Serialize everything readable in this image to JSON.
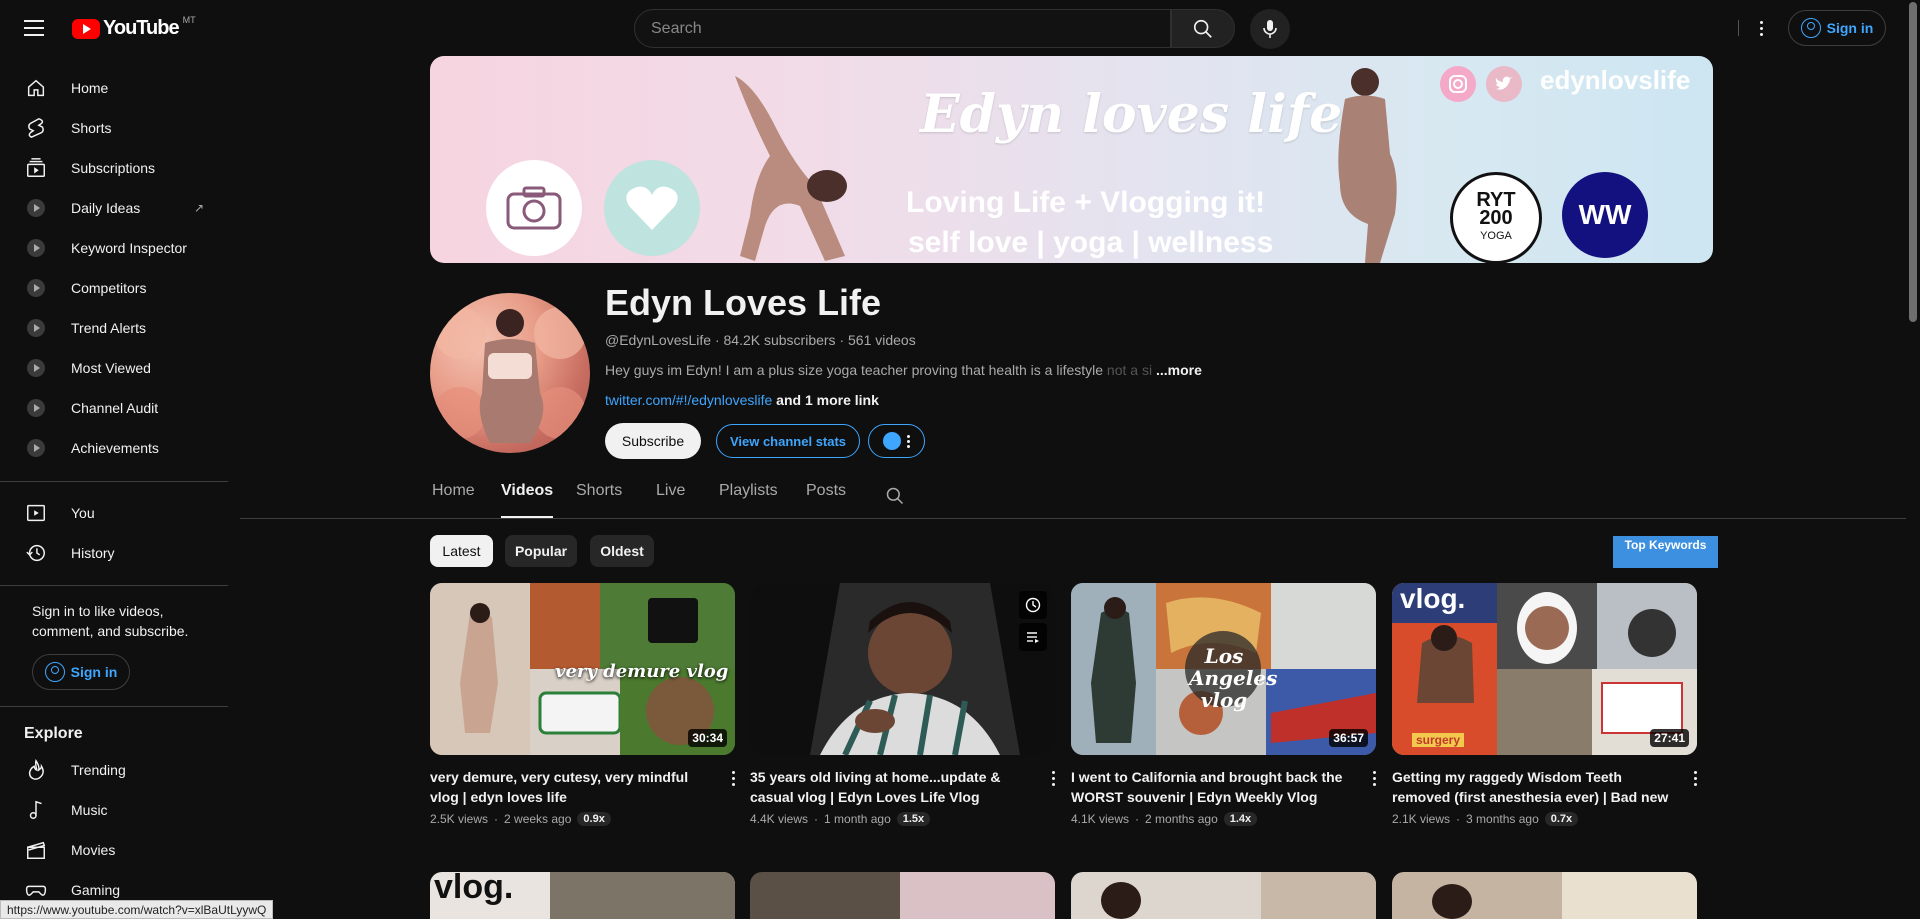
{
  "header": {
    "logo_text": "YouTube",
    "country_code": "MT",
    "search_placeholder": "Search",
    "signin_label": "Sign in"
  },
  "sidebar": {
    "items": [
      {
        "label": "Home",
        "icon": "home-icon"
      },
      {
        "label": "Shorts",
        "icon": "shorts-icon"
      },
      {
        "label": "Subscriptions",
        "icon": "subscriptions-icon"
      },
      {
        "label": "Daily Ideas",
        "icon": "extension-icon"
      },
      {
        "label": "Keyword Inspector",
        "icon": "extension-icon"
      },
      {
        "label": "Competitors",
        "icon": "extension-icon"
      },
      {
        "label": "Trend Alerts",
        "icon": "extension-icon"
      },
      {
        "label": "Most Viewed",
        "icon": "extension-icon"
      },
      {
        "label": "Channel Audit",
        "icon": "extension-icon"
      },
      {
        "label": "Achievements",
        "icon": "extension-icon"
      }
    ],
    "you_items": [
      {
        "label": "You",
        "icon": "you-icon"
      },
      {
        "label": "History",
        "icon": "history-icon"
      }
    ],
    "signin_prompt": "Sign in to like videos, comment, and subscribe.",
    "signin_label": "Sign in",
    "explore_heading": "Explore",
    "explore_items": [
      {
        "label": "Trending",
        "icon": "trending-icon"
      },
      {
        "label": "Music",
        "icon": "music-icon"
      },
      {
        "label": "Movies",
        "icon": "movies-icon"
      },
      {
        "label": "Gaming",
        "icon": "gaming-icon"
      }
    ]
  },
  "banner": {
    "title": "Edyn loves life",
    "tagline1": "Loving Life + Vlogging it!",
    "tagline2": "self love | yoga | wellness",
    "handle": "edynlovslife",
    "ryt_top": "RYT",
    "ryt_num": "200",
    "ryt_yoga": "YOGA",
    "ww": "WW"
  },
  "channel": {
    "name": "Edyn Loves Life",
    "meta": "@EdynLovesLife · 84.2K subscribers · 561 videos",
    "description_visible": "Hey guys im Edyn!  I am a plus size yoga teacher proving that health is a lifestyle ",
    "description_faded": "not a si",
    "more_label": "...more",
    "link_text": "twitter.com/#!/edynloveslife",
    "link_more": " and 1 more link",
    "subscribe_label": "Subscribe",
    "stats_label": "View channel stats"
  },
  "tabs": [
    {
      "label": "Home"
    },
    {
      "label": "Videos",
      "active": true
    },
    {
      "label": "Shorts"
    },
    {
      "label": "Live"
    },
    {
      "label": "Playlists"
    },
    {
      "label": "Posts"
    }
  ],
  "chips": [
    {
      "label": "Latest",
      "selected": true
    },
    {
      "label": "Popular"
    },
    {
      "label": "Oldest"
    }
  ],
  "top_keywords_label": "Top Keywords",
  "videos": [
    {
      "title": "very demure, very cutesy, very mindful vlog | edyn loves life",
      "views": "2.5K views",
      "age": "2 weeks ago",
      "ratio": "0.9x",
      "duration": "30:34",
      "thumb_text": "very demure vlog"
    },
    {
      "title": "35 years old living at home...update & casual vlog | Edyn Loves Life Vlog",
      "views": "4.4K views",
      "age": "1 month ago",
      "ratio": "1.5x",
      "duration": ""
    },
    {
      "title": "I went to California and brought back the WORST souvenir | Edyn Weekly Vlog",
      "views": "4.1K views",
      "age": "2 months ago",
      "ratio": "1.4x",
      "duration": "36:57",
      "thumb_text": "Los Angeles vlog"
    },
    {
      "title": "Getting my raggedy Wisdom Teeth removed (first anesthesia ever) | Bad new for Austin...",
      "views": "2.1K views",
      "age": "3 months ago",
      "ratio": "0.7x",
      "duration": "27:41",
      "thumb_text": "vlog.",
      "thumb_text2": "surgery"
    }
  ],
  "row2_text": "vlog.",
  "status_url": "https://www.youtube.com/watch?v=xlBaUtLyywQ",
  "colors": {
    "background": "#0f0f0f",
    "accent_blue": "#3ea6ff",
    "brand_red": "#ff0000",
    "top_keywords_bg": "#3d8fe0"
  }
}
